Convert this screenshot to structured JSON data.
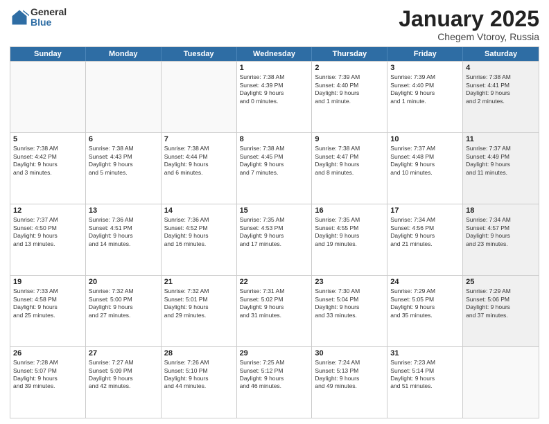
{
  "logo": {
    "general": "General",
    "blue": "Blue"
  },
  "title": "January 2025",
  "subtitle": "Chegem Vtoroy, Russia",
  "days": [
    "Sunday",
    "Monday",
    "Tuesday",
    "Wednesday",
    "Thursday",
    "Friday",
    "Saturday"
  ],
  "rows": [
    [
      {
        "num": "",
        "lines": [],
        "shaded": false,
        "empty": true
      },
      {
        "num": "",
        "lines": [],
        "shaded": false,
        "empty": true
      },
      {
        "num": "",
        "lines": [],
        "shaded": false,
        "empty": true
      },
      {
        "num": "1",
        "lines": [
          "Sunrise: 7:38 AM",
          "Sunset: 4:39 PM",
          "Daylight: 9 hours",
          "and 0 minutes."
        ],
        "shaded": false,
        "empty": false
      },
      {
        "num": "2",
        "lines": [
          "Sunrise: 7:39 AM",
          "Sunset: 4:40 PM",
          "Daylight: 9 hours",
          "and 1 minute."
        ],
        "shaded": false,
        "empty": false
      },
      {
        "num": "3",
        "lines": [
          "Sunrise: 7:39 AM",
          "Sunset: 4:40 PM",
          "Daylight: 9 hours",
          "and 1 minute."
        ],
        "shaded": false,
        "empty": false
      },
      {
        "num": "4",
        "lines": [
          "Sunrise: 7:38 AM",
          "Sunset: 4:41 PM",
          "Daylight: 9 hours",
          "and 2 minutes."
        ],
        "shaded": true,
        "empty": false
      }
    ],
    [
      {
        "num": "5",
        "lines": [
          "Sunrise: 7:38 AM",
          "Sunset: 4:42 PM",
          "Daylight: 9 hours",
          "and 3 minutes."
        ],
        "shaded": false,
        "empty": false
      },
      {
        "num": "6",
        "lines": [
          "Sunrise: 7:38 AM",
          "Sunset: 4:43 PM",
          "Daylight: 9 hours",
          "and 5 minutes."
        ],
        "shaded": false,
        "empty": false
      },
      {
        "num": "7",
        "lines": [
          "Sunrise: 7:38 AM",
          "Sunset: 4:44 PM",
          "Daylight: 9 hours",
          "and 6 minutes."
        ],
        "shaded": false,
        "empty": false
      },
      {
        "num": "8",
        "lines": [
          "Sunrise: 7:38 AM",
          "Sunset: 4:45 PM",
          "Daylight: 9 hours",
          "and 7 minutes."
        ],
        "shaded": false,
        "empty": false
      },
      {
        "num": "9",
        "lines": [
          "Sunrise: 7:38 AM",
          "Sunset: 4:47 PM",
          "Daylight: 9 hours",
          "and 8 minutes."
        ],
        "shaded": false,
        "empty": false
      },
      {
        "num": "10",
        "lines": [
          "Sunrise: 7:37 AM",
          "Sunset: 4:48 PM",
          "Daylight: 9 hours",
          "and 10 minutes."
        ],
        "shaded": false,
        "empty": false
      },
      {
        "num": "11",
        "lines": [
          "Sunrise: 7:37 AM",
          "Sunset: 4:49 PM",
          "Daylight: 9 hours",
          "and 11 minutes."
        ],
        "shaded": true,
        "empty": false
      }
    ],
    [
      {
        "num": "12",
        "lines": [
          "Sunrise: 7:37 AM",
          "Sunset: 4:50 PM",
          "Daylight: 9 hours",
          "and 13 minutes."
        ],
        "shaded": false,
        "empty": false
      },
      {
        "num": "13",
        "lines": [
          "Sunrise: 7:36 AM",
          "Sunset: 4:51 PM",
          "Daylight: 9 hours",
          "and 14 minutes."
        ],
        "shaded": false,
        "empty": false
      },
      {
        "num": "14",
        "lines": [
          "Sunrise: 7:36 AM",
          "Sunset: 4:52 PM",
          "Daylight: 9 hours",
          "and 16 minutes."
        ],
        "shaded": false,
        "empty": false
      },
      {
        "num": "15",
        "lines": [
          "Sunrise: 7:35 AM",
          "Sunset: 4:53 PM",
          "Daylight: 9 hours",
          "and 17 minutes."
        ],
        "shaded": false,
        "empty": false
      },
      {
        "num": "16",
        "lines": [
          "Sunrise: 7:35 AM",
          "Sunset: 4:55 PM",
          "Daylight: 9 hours",
          "and 19 minutes."
        ],
        "shaded": false,
        "empty": false
      },
      {
        "num": "17",
        "lines": [
          "Sunrise: 7:34 AM",
          "Sunset: 4:56 PM",
          "Daylight: 9 hours",
          "and 21 minutes."
        ],
        "shaded": false,
        "empty": false
      },
      {
        "num": "18",
        "lines": [
          "Sunrise: 7:34 AM",
          "Sunset: 4:57 PM",
          "Daylight: 9 hours",
          "and 23 minutes."
        ],
        "shaded": true,
        "empty": false
      }
    ],
    [
      {
        "num": "19",
        "lines": [
          "Sunrise: 7:33 AM",
          "Sunset: 4:58 PM",
          "Daylight: 9 hours",
          "and 25 minutes."
        ],
        "shaded": false,
        "empty": false
      },
      {
        "num": "20",
        "lines": [
          "Sunrise: 7:32 AM",
          "Sunset: 5:00 PM",
          "Daylight: 9 hours",
          "and 27 minutes."
        ],
        "shaded": false,
        "empty": false
      },
      {
        "num": "21",
        "lines": [
          "Sunrise: 7:32 AM",
          "Sunset: 5:01 PM",
          "Daylight: 9 hours",
          "and 29 minutes."
        ],
        "shaded": false,
        "empty": false
      },
      {
        "num": "22",
        "lines": [
          "Sunrise: 7:31 AM",
          "Sunset: 5:02 PM",
          "Daylight: 9 hours",
          "and 31 minutes."
        ],
        "shaded": false,
        "empty": false
      },
      {
        "num": "23",
        "lines": [
          "Sunrise: 7:30 AM",
          "Sunset: 5:04 PM",
          "Daylight: 9 hours",
          "and 33 minutes."
        ],
        "shaded": false,
        "empty": false
      },
      {
        "num": "24",
        "lines": [
          "Sunrise: 7:29 AM",
          "Sunset: 5:05 PM",
          "Daylight: 9 hours",
          "and 35 minutes."
        ],
        "shaded": false,
        "empty": false
      },
      {
        "num": "25",
        "lines": [
          "Sunrise: 7:29 AM",
          "Sunset: 5:06 PM",
          "Daylight: 9 hours",
          "and 37 minutes."
        ],
        "shaded": true,
        "empty": false
      }
    ],
    [
      {
        "num": "26",
        "lines": [
          "Sunrise: 7:28 AM",
          "Sunset: 5:07 PM",
          "Daylight: 9 hours",
          "and 39 minutes."
        ],
        "shaded": false,
        "empty": false
      },
      {
        "num": "27",
        "lines": [
          "Sunrise: 7:27 AM",
          "Sunset: 5:09 PM",
          "Daylight: 9 hours",
          "and 42 minutes."
        ],
        "shaded": false,
        "empty": false
      },
      {
        "num": "28",
        "lines": [
          "Sunrise: 7:26 AM",
          "Sunset: 5:10 PM",
          "Daylight: 9 hours",
          "and 44 minutes."
        ],
        "shaded": false,
        "empty": false
      },
      {
        "num": "29",
        "lines": [
          "Sunrise: 7:25 AM",
          "Sunset: 5:12 PM",
          "Daylight: 9 hours",
          "and 46 minutes."
        ],
        "shaded": false,
        "empty": false
      },
      {
        "num": "30",
        "lines": [
          "Sunrise: 7:24 AM",
          "Sunset: 5:13 PM",
          "Daylight: 9 hours",
          "and 49 minutes."
        ],
        "shaded": false,
        "empty": false
      },
      {
        "num": "31",
        "lines": [
          "Sunrise: 7:23 AM",
          "Sunset: 5:14 PM",
          "Daylight: 9 hours",
          "and 51 minutes."
        ],
        "shaded": false,
        "empty": false
      },
      {
        "num": "",
        "lines": [],
        "shaded": true,
        "empty": true
      }
    ]
  ]
}
